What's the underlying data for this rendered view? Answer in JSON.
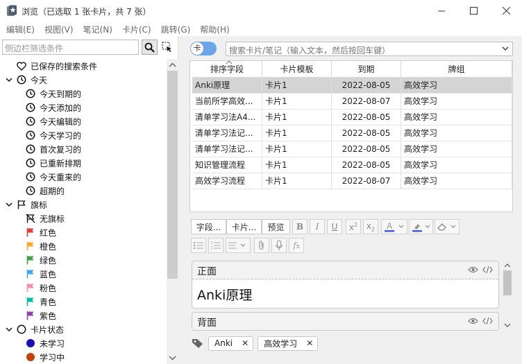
{
  "window": {
    "title": "浏览（已选取 1 张卡片，共 7 张）"
  },
  "menu": [
    "编辑(E)",
    "视图(V)",
    "笔记(N)",
    "卡片(C)",
    "跳转(G)",
    "帮助(H)"
  ],
  "sidebar": {
    "search_placeholder": "侧边栏筛选条件",
    "items": [
      {
        "label": "已保存的搜索条件",
        "icon": "heart-icon",
        "indent": 0,
        "arrow": ""
      },
      {
        "label": "今天",
        "icon": "clock-icon",
        "indent": 0,
        "arrow": "down"
      },
      {
        "label": "今天到期的",
        "icon": "clock-icon",
        "indent": 1,
        "arrow": ""
      },
      {
        "label": "今天添加的",
        "icon": "clock-icon",
        "indent": 1,
        "arrow": ""
      },
      {
        "label": "今天编辑的",
        "icon": "clock-icon",
        "indent": 1,
        "arrow": ""
      },
      {
        "label": "今天学习的",
        "icon": "clock-icon",
        "indent": 1,
        "arrow": ""
      },
      {
        "label": "首次复习的",
        "icon": "clock-icon",
        "indent": 1,
        "arrow": ""
      },
      {
        "label": "已重新排期",
        "icon": "clock-icon",
        "indent": 1,
        "arrow": ""
      },
      {
        "label": "今天重来的",
        "icon": "clock-icon",
        "indent": 1,
        "arrow": ""
      },
      {
        "label": "超期的",
        "icon": "clock-icon",
        "indent": 1,
        "arrow": ""
      },
      {
        "label": "旗标",
        "icon": "flag-outline-icon",
        "indent": 0,
        "arrow": "down"
      },
      {
        "label": "无旗标",
        "icon": "flag-off-icon",
        "indent": 1,
        "arrow": ""
      },
      {
        "label": "红色",
        "icon": "flag-icon",
        "color": "#e53935",
        "indent": 1,
        "arrow": ""
      },
      {
        "label": "橙色",
        "icon": "flag-icon",
        "color": "#ffa726",
        "indent": 1,
        "arrow": ""
      },
      {
        "label": "绿色",
        "icon": "flag-icon",
        "color": "#43a047",
        "indent": 1,
        "arrow": ""
      },
      {
        "label": "蓝色",
        "icon": "flag-icon",
        "color": "#42a5f5",
        "indent": 1,
        "arrow": ""
      },
      {
        "label": "粉色",
        "icon": "flag-icon",
        "color": "#f48fb1",
        "indent": 1,
        "arrow": ""
      },
      {
        "label": "青色",
        "icon": "flag-icon",
        "color": "#00bfa5",
        "indent": 1,
        "arrow": ""
      },
      {
        "label": "紫色",
        "icon": "flag-icon",
        "color": "#8e44ad",
        "indent": 1,
        "arrow": ""
      },
      {
        "label": "卡片状态",
        "icon": "circle-outline-icon",
        "indent": 0,
        "arrow": "down"
      },
      {
        "label": "未学习",
        "icon": "dot-icon",
        "color": "#1a0fb4",
        "indent": 1,
        "arrow": ""
      },
      {
        "label": "学习中",
        "icon": "dot-icon",
        "color": "#c2410c",
        "indent": 1,
        "arrow": ""
      }
    ]
  },
  "toggle_label": "卡",
  "main_search_placeholder": "搜索卡片/笔记（输入文本，然后按回车键）",
  "table": {
    "headers": [
      "排序字段",
      "卡片模板",
      "到期",
      "牌组"
    ],
    "rows": [
      [
        "Anki原理",
        "卡片1",
        "2022-08-05",
        "高效学习"
      ],
      [
        "当前所学高效...",
        "卡片1",
        "2022-08-07",
        "高效学习"
      ],
      [
        "清单学习法A4...",
        "卡片1",
        "2022-08-05",
        "高效学习"
      ],
      [
        "清单学习法记...",
        "卡片1",
        "2022-08-05",
        "高效学习"
      ],
      [
        "清单学习法记...",
        "卡片1",
        "2022-08-05",
        "高效学习"
      ],
      [
        "知识管理流程",
        "卡片1",
        "2022-08-05",
        "高效学习"
      ],
      [
        "高效学习流程",
        "卡片1",
        "2022-08-07",
        "高效学习"
      ]
    ],
    "selected_row": 0
  },
  "editor": {
    "fields_btn": "字段...",
    "cards_btn": "卡片...",
    "preview_btn": "预览",
    "fields": [
      {
        "name": "正面",
        "content": "Anki原理"
      },
      {
        "name": "背面",
        "content": ""
      }
    ],
    "tags": [
      "Anki",
      "高效学习"
    ]
  }
}
